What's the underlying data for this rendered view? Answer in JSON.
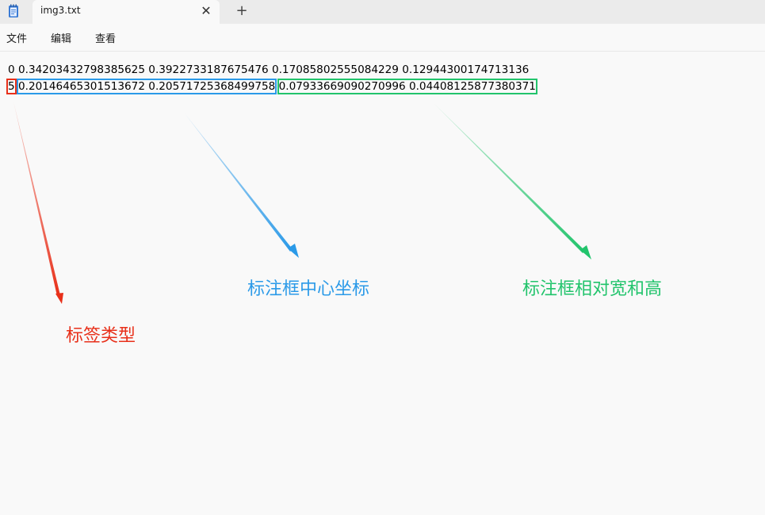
{
  "tab": {
    "title": "img3.txt",
    "close_glyph": "✕",
    "new_tab_glyph": "+"
  },
  "icons": {
    "app": "notepad-icon",
    "close": "close-icon",
    "new_tab": "plus-icon"
  },
  "menu": {
    "file": "文件",
    "edit": "编辑",
    "view": "查看"
  },
  "content": {
    "line1": "0 0.34203432798385625 0.3922733187675476 0.17085802555084229 0.12944300174713136",
    "line2": {
      "class_id": "5",
      "center": "0.20146465301513672 0.20571725368499758",
      "size": "0.07933669090270996 0.04408125877380371"
    }
  },
  "annotations": {
    "type_label": "标签类型",
    "center_label": "标注框中心坐标",
    "size_label": "标注框相对宽和高"
  },
  "colors": {
    "red": "#e8301a",
    "blue": "#2b9ae8",
    "green": "#22c46c"
  }
}
